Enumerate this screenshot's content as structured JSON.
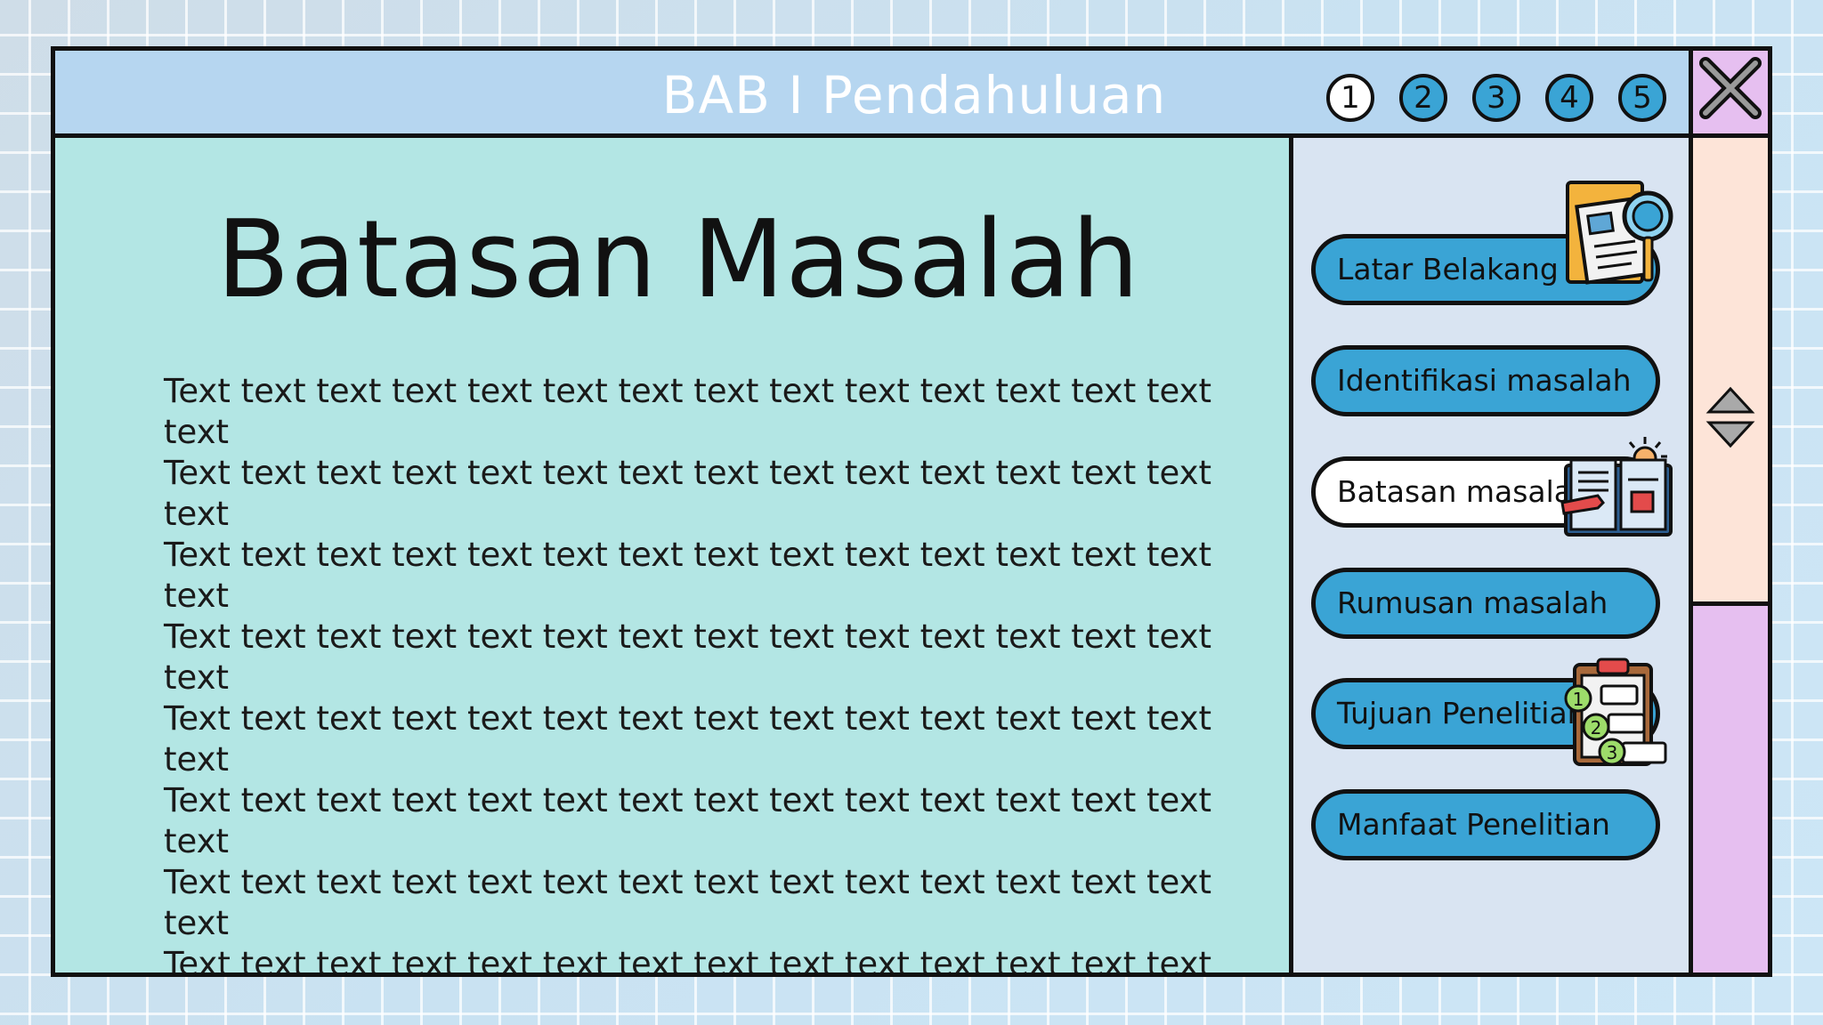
{
  "window": {
    "title": "BAB I Pendahuluan"
  },
  "pages": [
    {
      "label": "1",
      "active": true
    },
    {
      "label": "2",
      "active": false
    },
    {
      "label": "3",
      "active": false
    },
    {
      "label": "4",
      "active": false
    },
    {
      "label": "5",
      "active": false
    }
  ],
  "main": {
    "heading": "Batasan Masalah",
    "paragraph_lines": [
      "Text text text text text text text text text text text text text text text",
      "Text text text text text text text text text text text text text text text",
      "Text text text text text text text text text text text text text text text",
      "Text text text text text text text text text text text text text text text",
      "Text text text text text text text text text text text text text text text",
      "Text text text text text text text text text text text text text text text",
      "Text text text text text text text text text text text text text text text",
      "Text text text text text text text text text text text text text text text"
    ]
  },
  "sidebar": {
    "items": [
      {
        "label": "Latar Belakang",
        "active": false,
        "icon": "document-magnifier-icon"
      },
      {
        "label": "Identifikasi masalah",
        "active": false,
        "icon": ""
      },
      {
        "label": "Batasan masalah",
        "active": true,
        "icon": "book-lightbulb-icon"
      },
      {
        "label": "Rumusan masalah",
        "active": false,
        "icon": ""
      },
      {
        "label": "Tujuan Penelitian",
        "active": false,
        "icon": "clipboard-checklist-icon"
      },
      {
        "label": "Manfaat Penelitian",
        "active": false,
        "icon": ""
      }
    ]
  },
  "colors": {
    "titlebar": "#b6d6f0",
    "main_panel": "#b3e6e4",
    "sidebar": "#d9e4f2",
    "nav_button": "#3aa4d5",
    "nav_button_active": "#ffffff",
    "scroll_top": "#fde4d8",
    "scroll_bottom": "#e6bff0",
    "close_button": "#e6bff0"
  }
}
